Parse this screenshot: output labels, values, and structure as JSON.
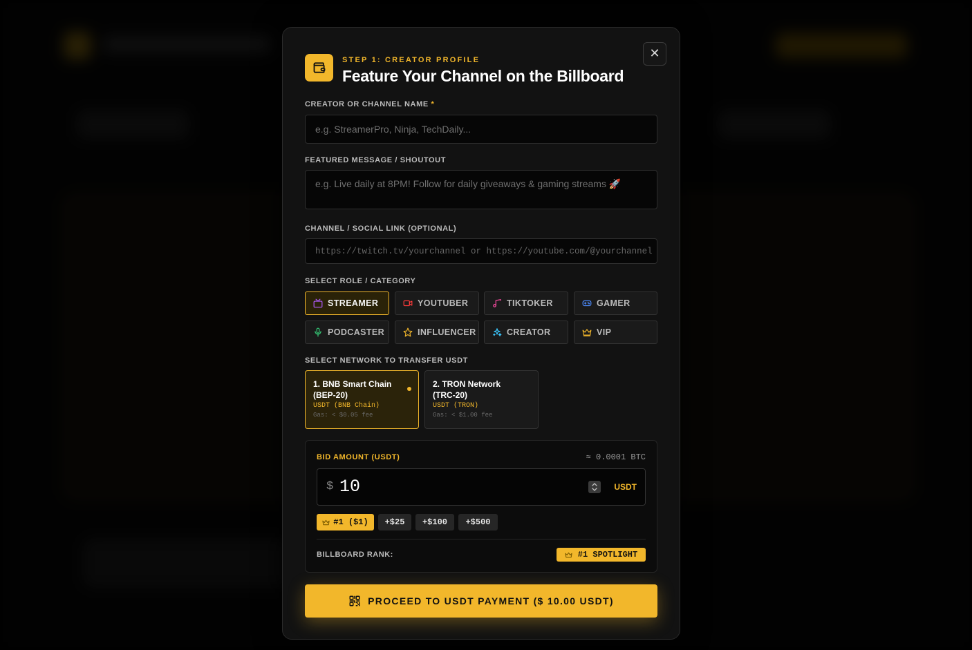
{
  "modal": {
    "step_label": "STEP 1: CREATOR PROFILE",
    "title": "Feature Your Channel on the Billboard",
    "close_glyph": "✕"
  },
  "form": {
    "name_label": "CREATOR OR CHANNEL NAME",
    "required_mark": "*",
    "name_placeholder": "e.g. StreamerPro, Ninja, TechDaily...",
    "message_label": "FEATURED MESSAGE / SHOUTOUT",
    "message_placeholder": "e.g. Live daily at 8PM! Follow for daily giveaways & gaming streams 🚀",
    "link_label": "CHANNEL / SOCIAL LINK (OPTIONAL)",
    "link_placeholder": "https://twitch.tv/yourchannel or https://youtube.com/@yourchannel",
    "role_label": "SELECT ROLE / CATEGORY",
    "roles": [
      {
        "label": "STREAMER",
        "icon": "tv-icon",
        "color": "#b15cff",
        "selected": true
      },
      {
        "label": "YOUTUBER",
        "icon": "video-icon",
        "color": "#ff3b3b",
        "selected": false
      },
      {
        "label": "TIKTOKER",
        "icon": "music-note-icon",
        "color": "#ff4da6",
        "selected": false
      },
      {
        "label": "GAMER",
        "icon": "gamepad-icon",
        "color": "#4d8cff",
        "selected": false
      },
      {
        "label": "PODCASTER",
        "icon": "microphone-icon",
        "color": "#36d07a",
        "selected": false
      },
      {
        "label": "INFLUENCER",
        "icon": "star-icon",
        "color": "#f2b72b",
        "selected": false
      },
      {
        "label": "CREATOR",
        "icon": "sparkles-icon",
        "color": "#3bc8ff",
        "selected": false
      },
      {
        "label": "VIP",
        "icon": "crown-icon",
        "color": "#f2b72b",
        "selected": false
      }
    ],
    "network_label": "SELECT NETWORK TO TRANSFER USDT",
    "networks": [
      {
        "name": "1. BNB Smart Chain (BEP-20)",
        "token": "USDT (BNB Chain)",
        "gas": "Gas: < $0.05 fee",
        "selected": true
      },
      {
        "name": "2. TRON Network (TRC-20)",
        "token": "USDT (TRON)",
        "gas": "Gas: < $1.00 fee",
        "selected": false
      }
    ]
  },
  "bid": {
    "label": "BID AMOUNT (USDT)",
    "btc_equiv": "≈ 0.0001 BTC",
    "currency_symbol": "$",
    "amount": "10",
    "unit": "USDT",
    "chips": [
      "#1 ($1)",
      "+$25",
      "+$100",
      "+$500"
    ],
    "rank_label": "BILLBOARD RANK:",
    "rank_value": "#1 SPOTLIGHT"
  },
  "cta": {
    "label": "PROCEED TO USDT PAYMENT ($ 10.00 USDT)"
  },
  "colors": {
    "accent": "#f2b72b",
    "modal_bg": "#121212",
    "input_bg": "#060606"
  }
}
